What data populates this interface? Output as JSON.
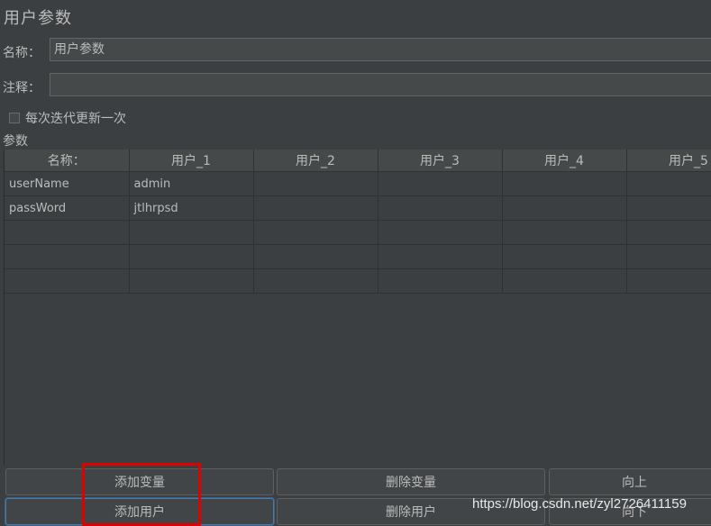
{
  "panel": {
    "title": "用户参数",
    "name_label": "名称：",
    "name_value": "用户参数",
    "comment_label": "注释：",
    "comment_value": "",
    "checkbox_label": "每次迭代更新一次",
    "checkbox_checked": false,
    "section_label": "参数"
  },
  "table": {
    "columns": [
      "名称：",
      "用户_1",
      "用户_2",
      "用户_3",
      "用户_4",
      "用户_5"
    ],
    "rows": [
      [
        "userName",
        "admin",
        "",
        "",
        "",
        ""
      ],
      [
        "passWord",
        "jtlhrpsd",
        "",
        "",
        "",
        ""
      ],
      [
        "",
        "",
        "",
        "",
        "",
        ""
      ],
      [
        "",
        "",
        "",
        "",
        "",
        ""
      ],
      [
        "",
        "",
        "",
        "",
        "",
        ""
      ]
    ]
  },
  "buttons": {
    "add_variable": "添加变量",
    "delete_variable": "删除变量",
    "move_up": "向上",
    "add_user": "添加用户",
    "delete_user": "删除用户",
    "move_down": "向下"
  },
  "watermark": "https://blog.csdn.net/zyl2726411159",
  "colors": {
    "background": "#3c3f41",
    "text": "#bbbbbb",
    "highlight": "#e10000"
  }
}
